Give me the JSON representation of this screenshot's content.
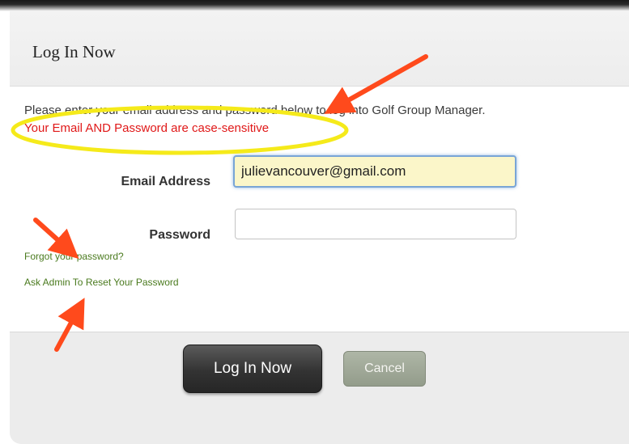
{
  "dialog": {
    "title": "Log In Now",
    "intro": "Please enter your email address and password below to log into Golf Group Manager.",
    "warning": "Your Email AND Password are case-sensitive"
  },
  "form": {
    "email_label": "Email Address",
    "email_value": "julievancouver@gmail.com",
    "password_label": "Password",
    "password_value": ""
  },
  "links": {
    "forgot": "Forgot your password?",
    "reset": "Ask Admin To Reset Your Password"
  },
  "buttons": {
    "login": "Log In Now",
    "cancel": "Cancel"
  },
  "colors": {
    "warning": "#e01818",
    "link": "#4a7a1e",
    "annotation_arrow": "#ff4a1c",
    "annotation_highlight": "#f5ea1a",
    "email_field_bg": "#fbf6c9"
  }
}
